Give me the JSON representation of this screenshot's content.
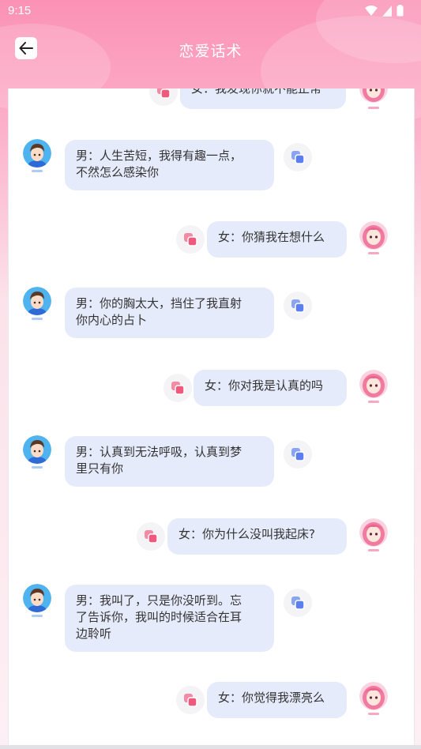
{
  "status": {
    "time": "9:15"
  },
  "header": {
    "title": "恋爱话术"
  },
  "colors": {
    "male_accent": "#5b7ff0",
    "female_accent": "#f0587c",
    "bubble": "#e6ebfb"
  },
  "icons": {
    "back": "arrow-left-icon",
    "copy": "copy-icon"
  },
  "messages": [
    {
      "role": "female",
      "text": "女：我发现你就不能正常"
    },
    {
      "role": "male",
      "text": "男：人生苦短，我得有趣一点，\n不然怎么感染你"
    },
    {
      "role": "female",
      "text": "女：你猜我在想什么"
    },
    {
      "role": "male",
      "text": "男：你的胸太大，挡住了我直射\n你内心的占卜"
    },
    {
      "role": "female",
      "text": "女：你对我是认真的吗"
    },
    {
      "role": "male",
      "text": "男：认真到无法呼吸，认真到梦\n里只有你"
    },
    {
      "role": "female",
      "text": "女：你为什么没叫我起床?"
    },
    {
      "role": "male",
      "text": "男：我叫了，只是你没听到。忘\n了告诉你，我叫的时候适合在耳\n边聆听"
    },
    {
      "role": "female",
      "text": "女：你觉得我漂亮么"
    }
  ]
}
